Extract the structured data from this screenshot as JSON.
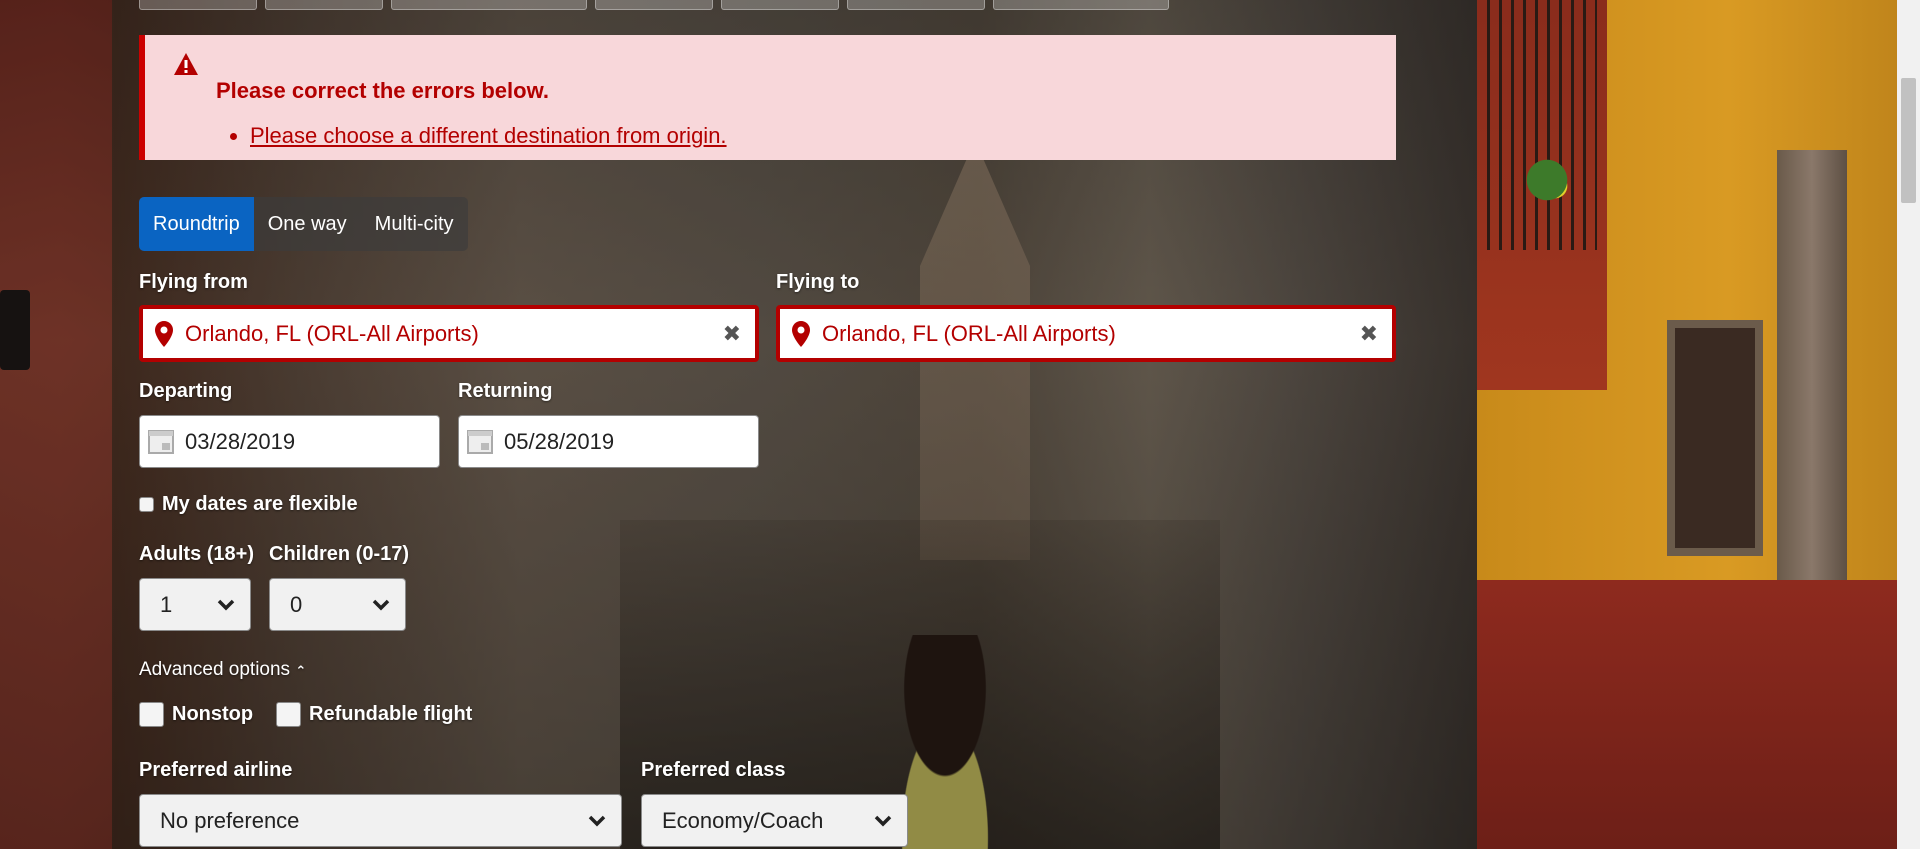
{
  "alert": {
    "title": "Please correct the errors below.",
    "errors": [
      "Please choose a different destination from origin."
    ]
  },
  "trip_type": {
    "options": [
      "Roundtrip",
      "One way",
      "Multi-city"
    ],
    "selected": "Roundtrip"
  },
  "flying_from": {
    "label": "Flying from",
    "value": "Orlando, FL (ORL-All Airports)"
  },
  "flying_to": {
    "label": "Flying to",
    "value": "Orlando, FL (ORL-All Airports)"
  },
  "departing": {
    "label": "Departing",
    "value": "03/28/2019"
  },
  "returning": {
    "label": "Returning",
    "value": "05/28/2019"
  },
  "flexible": {
    "label": "My dates are flexible",
    "checked": false
  },
  "adults": {
    "label": "Adults (18+)",
    "value": "1"
  },
  "children": {
    "label": "Children (0-17)",
    "value": "0"
  },
  "advanced": {
    "label": "Advanced options"
  },
  "nonstop": {
    "label": "Nonstop",
    "checked": false
  },
  "refundable": {
    "label": "Refundable flight",
    "checked": false
  },
  "airline": {
    "label": "Preferred airline",
    "value": "No preference"
  },
  "class": {
    "label": "Preferred class",
    "value": "Economy/Coach"
  },
  "colors": {
    "error": "#b30000",
    "error_bg": "#f8d7da",
    "accent": "#0a64c2"
  },
  "icons": {
    "clear": "close-icon",
    "pin": "map-pin-icon",
    "calendar": "calendar-icon",
    "warning": "warning-icon",
    "chevron": "chevron-down-icon"
  }
}
